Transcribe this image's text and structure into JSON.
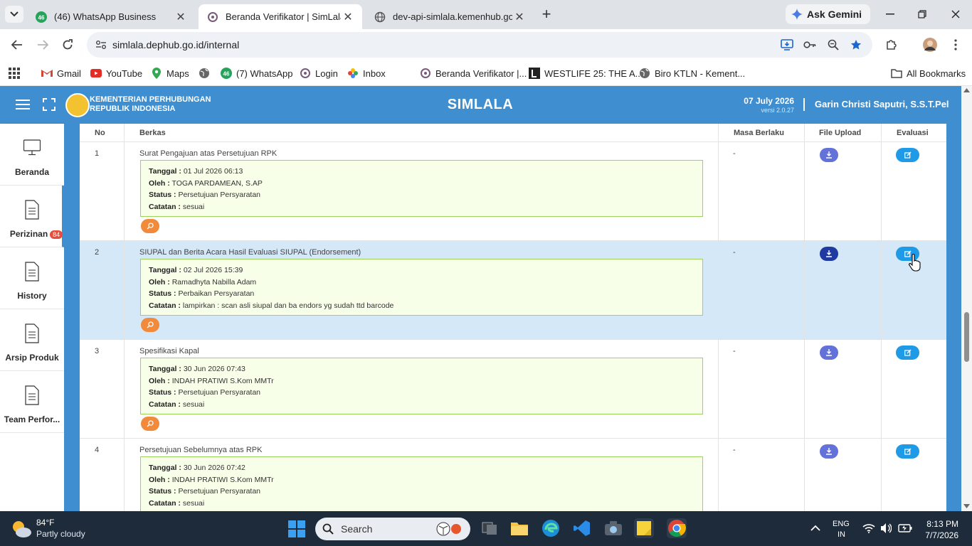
{
  "browser": {
    "tabs": [
      {
        "title": "(46) WhatsApp Business",
        "badge": "46",
        "active": false
      },
      {
        "title": "Beranda Verifikator | SimLala",
        "active": true
      },
      {
        "title": "dev-api-simlala.kemenhub.go.id",
        "active": false
      }
    ],
    "gemini_label": "Ask Gemini",
    "url": "simlala.dephub.go.id/internal",
    "bookmarks": [
      {
        "label": "Gmail",
        "icon": "gmail-icon"
      },
      {
        "label": "YouTube",
        "icon": "youtube-icon"
      },
      {
        "label": "Maps",
        "icon": "maps-icon"
      },
      {
        "label": "",
        "icon": "globe-icon"
      },
      {
        "label": "(7) WhatsApp",
        "icon": "whatsapp-icon"
      },
      {
        "label": "Login",
        "icon": "login-icon"
      },
      {
        "label": "Inbox",
        "icon": "inbox-icon"
      },
      {
        "label": "Beranda Verifikator |...",
        "icon": "simlala-icon"
      },
      {
        "label": "WESTLIFE 25: THE A...",
        "icon": "westlife-icon"
      },
      {
        "label": "Biro KTLN - Kement...",
        "icon": "globe-icon"
      }
    ],
    "all_bookmarks": "All Bookmarks"
  },
  "header": {
    "ministry_line1": "KEMENTERIAN PERHUBUNGAN",
    "ministry_line2": "REPUBLIK INDONESIA",
    "app_title": "SIMLALA",
    "date": "07 July 2026",
    "version": "versi 2.0.27",
    "user": "Garin Christi Saputri, S.S.T.Pel"
  },
  "sidebar": [
    {
      "label": "Beranda",
      "icon": "monitor-icon"
    },
    {
      "label": "Perizinan",
      "icon": "document-icon",
      "badge": "84",
      "active": true
    },
    {
      "label": "History",
      "icon": "document-icon"
    },
    {
      "label": "Arsip Produk",
      "icon": "document-icon"
    },
    {
      "label": "Team Perfor...",
      "icon": "document-icon"
    }
  ],
  "table": {
    "headers": {
      "no": "No",
      "berkas": "Berkas",
      "masa": "Masa Berlaku",
      "upload": "File Upload",
      "evaluasi": "Evaluasi"
    },
    "field_labels": {
      "tanggal": "Tanggal :",
      "oleh": "Oleh :",
      "status": "Status :",
      "catatan": "Catatan :"
    },
    "rows": [
      {
        "no": "1",
        "title": "Surat Pengajuan atas Persetujuan RPK",
        "tanggal": "01 Jul 2026 06:13",
        "oleh": "TOGA PARDAMEAN, S.AP",
        "status": "Persetujuan Persyaratan",
        "catatan": "sesuai",
        "masa": "-"
      },
      {
        "no": "2",
        "title": "SIUPAL dan Berita Acara Hasil Evaluasi SIUPAL (Endorsement)",
        "tanggal": "02 Jul 2026 15:39",
        "oleh": "Ramadhyta Nabilla Adam",
        "status": "Perbaikan Persyaratan",
        "catatan": "lampirkan : scan asli siupal dan ba endors yg sudah ttd barcode",
        "masa": "-"
      },
      {
        "no": "3",
        "title": "Spesifikasi Kapal",
        "tanggal": "30 Jun 2026 07:43",
        "oleh": "INDAH PRATIWI S.Kom MMTr",
        "status": "Persetujuan Persyaratan",
        "catatan": "sesuai",
        "masa": "-"
      },
      {
        "no": "4",
        "title": "Persetujuan Sebelumnya atas RPK",
        "tanggal": "30 Jun 2026 07:42",
        "oleh": "INDAH PRATIWI S.Kom MMTr",
        "status": "Persetujuan Persyaratan",
        "catatan": "sesuai",
        "masa": "-"
      }
    ]
  },
  "taskbar": {
    "temp": "84°F",
    "weather": "Partly cloudy",
    "search_label": "Search",
    "lang1": "ENG",
    "lang2": "IN",
    "time": "8:13 PM",
    "date": "7/7/2026"
  },
  "colors": {
    "accent": "#3e8ed0",
    "highlight_row": "#d4e8f8",
    "note_box": "#f8ffe8",
    "note_border": "#9bd35d",
    "search_btn": "#f18a3a",
    "download_btn": "#6272d8",
    "eval_btn": "#1f9ae6"
  }
}
